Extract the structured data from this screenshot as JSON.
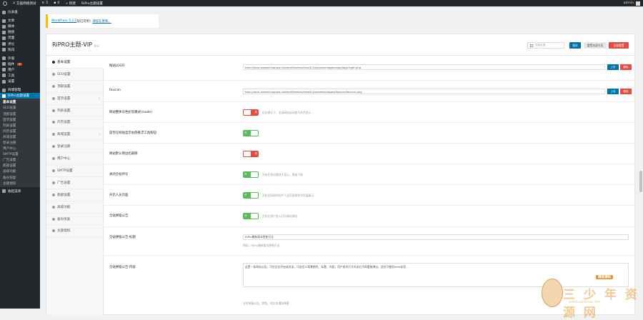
{
  "adminbar": {
    "site": "艾画网络测试",
    "updates": "5",
    "comments": "0",
    "new": "+ 新建",
    "theme_settings": "RiPro主题设置",
    "user": "admin"
  },
  "sidebar": {
    "items": [
      {
        "label": "仪表盘"
      },
      {
        "label": "文章"
      },
      {
        "label": "媒体"
      },
      {
        "label": "链接"
      },
      {
        "label": "页面"
      },
      {
        "label": "评论"
      },
      {
        "label": "快讯"
      },
      {
        "label": "外观"
      },
      {
        "label": "插件",
        "badge": "3"
      },
      {
        "label": "用户"
      },
      {
        "label": "工具"
      },
      {
        "label": "设置"
      },
      {
        "label": "商城管理"
      },
      {
        "label": "RiPro主题设置"
      }
    ],
    "submenu": [
      "基本设置",
      "SEO设置",
      "顶部设置",
      "首页设置",
      "列表设置",
      "内页设置",
      "商城设置",
      "登录注册",
      "用户中心",
      "SMTP设置",
      "广告设置",
      "底部设置",
      "高级功能",
      "备份恢复",
      "主题授权"
    ],
    "collapse": "收起菜单"
  },
  "notice": {
    "link1": "WordPress 5.2.2",
    "text": "现已可用！",
    "link2": "请现在更新。"
  },
  "panel": {
    "title": "RiPRO主题-VIP",
    "version": "Pro",
    "search_placeholder": "搜索设置",
    "save": "保存",
    "reset_section": "重置本部分区",
    "reset_all": "全部重置"
  },
  "tabs": [
    {
      "label": "基本设置"
    },
    {
      "label": "SEO设置"
    },
    {
      "label": "顶部设置"
    },
    {
      "label": "首页设置"
    },
    {
      "label": "列表设置"
    },
    {
      "label": "内页设置"
    },
    {
      "label": "商城设置"
    },
    {
      "label": "登录注册"
    },
    {
      "label": "用户中心"
    },
    {
      "label": "SMTP设置"
    },
    {
      "label": "广告设置"
    },
    {
      "label": "底部设置"
    },
    {
      "label": "高级功能"
    },
    {
      "label": "备份恢复"
    },
    {
      "label": "主题授权"
    }
  ],
  "fields": {
    "logo_label": "网站LOGO",
    "logo_value": "http://ripro.wzhost.top/wp-content/themes/ripro5.4/assets/images/logo/logo-light.png",
    "favicon_label": "favicon",
    "favicon_value": "http://ripro.wzhost.top/wp-content/themes/ripro5.4/assets/images/favicon/favicon.png",
    "upload": "上传",
    "remove": "删除",
    "gray_label": "网站整体灰色纪念模式(mode)",
    "gray_desc": "纪念模式下，全局网站自动变为灰色显示",
    "tools_label": "是否在网站显示右侧悬浮工具按钮",
    "sidebar_label": "网站默认侧边栏跟随",
    "comment_label": "关闭全站评论",
    "comment_desc": "开启后评论模块不显示，直接下掉",
    "author_label": "开启人员页面",
    "author_desc": "开启后网站的用户人员页面将作为页面展示",
    "ann_label": "全站弹窗公告",
    "ann_desc": "开启后用户进入打开网站弹出",
    "ann_title_label": "全站弹窗公告-标题",
    "ann_title_value": "RiPro最新版本更新日志",
    "ann_title_desc": "例如：RiPro最新版本更新日志",
    "ann_content_label": "全站弹窗公告-内容",
    "ann_content_value": "这是一条网站公告，可在后台开启或关闭，可自定义背景颜色、标题、内容，用户首次打开关闭后不再重复弹出，此处可使用html标签...",
    "ann_content_desc": "全站弹窗公告，颜色，纯文本通知弹窗",
    "toggle_on": "开",
    "toggle_off": "关"
  },
  "watermark": {
    "badge": "精美源码",
    "text": "三 少 年 资 源 网",
    "url": "www.sanshao.net"
  }
}
